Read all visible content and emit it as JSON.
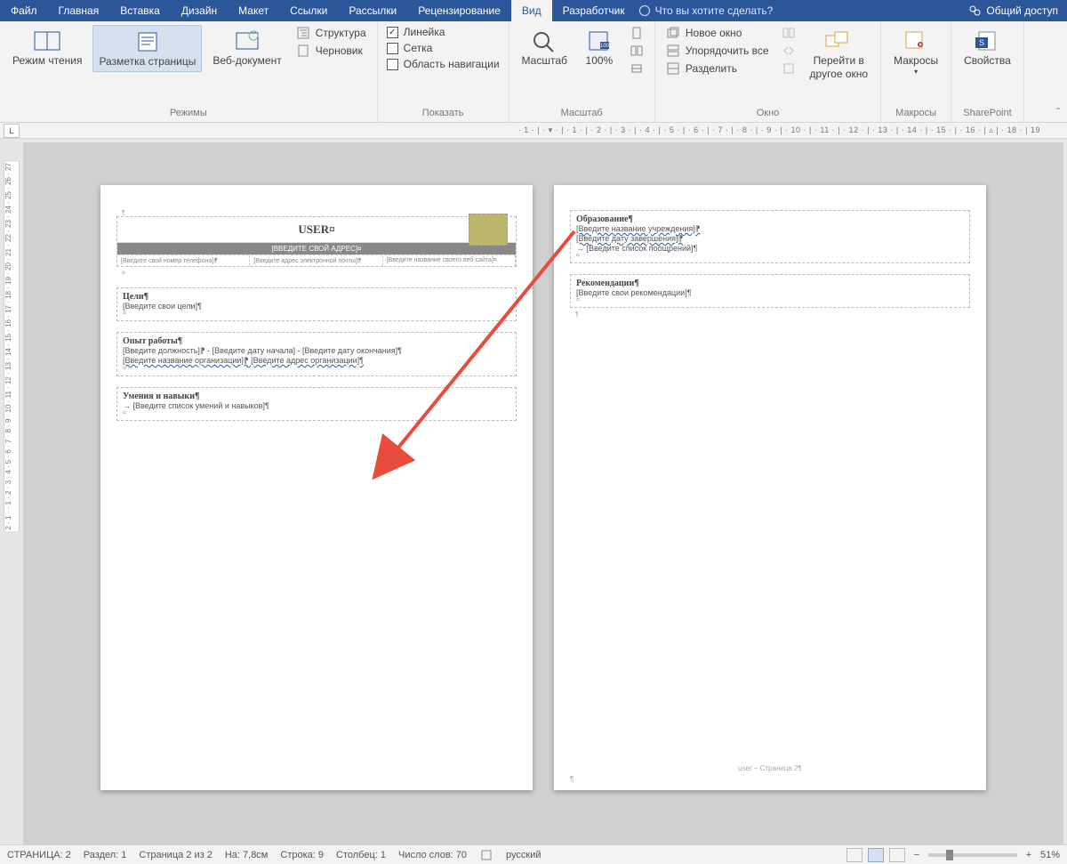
{
  "tabs": {
    "file": "Файл",
    "home": "Главная",
    "insert": "Вставка",
    "design": "Дизайн",
    "layout": "Макет",
    "references": "Ссылки",
    "mailings": "Рассылки",
    "review": "Рецензирование",
    "view": "Вид",
    "developer": "Разработчик",
    "tellme": "Что вы хотите сделать?",
    "share": "Общий доступ"
  },
  "ribbon": {
    "views": {
      "read": "Режим чтения",
      "print": "Разметка страницы",
      "web": "Веб-документ",
      "outline": "Структура",
      "draft": "Черновик",
      "group": "Режимы"
    },
    "show": {
      "ruler": "Линейка",
      "grid": "Сетка",
      "nav": "Область навигации",
      "group": "Показать"
    },
    "zoom": {
      "zoom": "Масштаб",
      "hundred": "100%",
      "group": "Масштаб"
    },
    "window": {
      "new": "Новое окно",
      "arrange": "Упорядочить все",
      "split": "Разделить",
      "switch1": "Перейти в",
      "switch2": "другое окно",
      "group": "Окно"
    },
    "macros": {
      "label": "Макросы",
      "group": "Макросы"
    },
    "sharepoint": {
      "label": "Свойства",
      "group": "SharePoint"
    }
  },
  "ruler": {
    "h": "· 1 · | · ▾ · | · 1 · | · 2 · | · 3 · | · 4 · | · 5 · | · 6 · | · 7 · | · 8 · | · 9 · | · 10 · | · 11 · | · 12 · | · 13 · | · 14 · | · 15 · | · 16 · | ▵ | · 18 · | 19",
    "tabchar": "L"
  },
  "page1": {
    "title": "USER¤",
    "subtitle": "[ВВЕДИТЕ СВОЙ АДРЕС]¤",
    "contact1": "[Введите свой номер телефона]⁋",
    "contact2": "[Введите адрес электронной почты]⁋",
    "contact3": "[Введите название своего веб-сайта]¤",
    "goals_h": "Цели¶",
    "goals_b": "[Введите свои цели]¶",
    "exp_h": "Опыт работы¶",
    "exp_l1": "[Введите должность]⁋ - [Введите дату начала] - [Введите дату окончания]¶",
    "exp_l2": "[Введите название организации]⁋  [Введите адрес организации]¶",
    "skills_h": "Умения и навыки¶",
    "skills_b": "→ [Введите список умений и навыков]¶"
  },
  "page2": {
    "edu_h": "Образование¶",
    "edu_l1": "[Введите название учреждения]⁋",
    "edu_l2": "[Введите дату завершения]⁋",
    "edu_l3": "→ [Введите список поощрений]¶",
    "rec_h": "Рекомендации¶",
    "rec_b": "[Введите свои рекомендации]¶",
    "footer": "user – Страница 2¶"
  },
  "status": {
    "page": "СТРАНИЦА: 2",
    "section": "Раздел: 1",
    "pageof": "Страница 2 из 2",
    "at": "На: 7,8см",
    "line": "Строка: 9",
    "col": "Столбец: 1",
    "words": "Число слов: 70",
    "lang": "русский",
    "zoom": "51%"
  }
}
